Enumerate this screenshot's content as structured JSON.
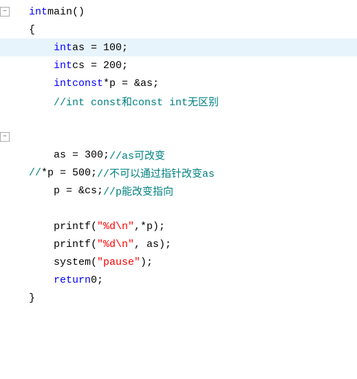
{
  "editor": {
    "lines": [
      {
        "id": "line-1",
        "indent": 0,
        "collapsible": true,
        "collapsed": false,
        "hasGuide": false,
        "tokens": [
          {
            "type": "kw-blue",
            "text": "int"
          },
          {
            "type": "normal",
            "text": " main()"
          }
        ]
      },
      {
        "id": "line-2",
        "indent": 0,
        "collapsible": false,
        "collapsed": false,
        "hasGuide": true,
        "tokens": [
          {
            "type": "normal",
            "text": "{"
          }
        ]
      },
      {
        "id": "line-3",
        "indent": 1,
        "collapsible": false,
        "collapsed": false,
        "hasGuide": true,
        "highlighted": true,
        "tokens": [
          {
            "type": "kw-blue",
            "text": "int"
          },
          {
            "type": "normal",
            "text": " as = 100;"
          }
        ]
      },
      {
        "id": "line-4",
        "indent": 1,
        "collapsible": false,
        "collapsed": false,
        "hasGuide": true,
        "tokens": [
          {
            "type": "kw-blue",
            "text": "int"
          },
          {
            "type": "normal",
            "text": " cs = 200;"
          }
        ]
      },
      {
        "id": "line-5",
        "indent": 1,
        "collapsible": false,
        "collapsed": false,
        "hasGuide": true,
        "tokens": [
          {
            "type": "kw-blue",
            "text": "int"
          },
          {
            "type": "normal",
            "text": " "
          },
          {
            "type": "kw-blue",
            "text": "const"
          },
          {
            "type": "normal",
            "text": " *p = &as;"
          }
        ]
      },
      {
        "id": "line-6",
        "indent": 1,
        "collapsible": false,
        "collapsed": false,
        "hasGuide": true,
        "tokens": [
          {
            "type": "comment",
            "text": "//int const和const int无区别"
          }
        ]
      },
      {
        "id": "line-7",
        "indent": 0,
        "collapsible": false,
        "collapsed": false,
        "hasGuide": false,
        "tokens": []
      },
      {
        "id": "line-8",
        "indent": 0,
        "collapsible": true,
        "collapsed": false,
        "hasGuide": false,
        "tokens": []
      },
      {
        "id": "line-9",
        "indent": 1,
        "collapsible": false,
        "collapsed": false,
        "hasGuide": true,
        "tokens": [
          {
            "type": "normal",
            "text": "as = 300;"
          },
          {
            "type": "comment",
            "text": "//as可改变"
          }
        ]
      },
      {
        "id": "line-10",
        "indent": 0,
        "collapsible": false,
        "collapsed": false,
        "hasGuide": false,
        "commentPrefix": true,
        "tokens": [
          {
            "type": "comment",
            "text": "//"
          },
          {
            "type": "normal",
            "text": "   *p = 500;"
          },
          {
            "type": "comment",
            "text": "//不可以通过指针改变as"
          }
        ]
      },
      {
        "id": "line-11",
        "indent": 1,
        "collapsible": false,
        "collapsed": false,
        "hasGuide": true,
        "tokens": [
          {
            "type": "normal",
            "text": "p = &cs;"
          },
          {
            "type": "comment",
            "text": "//p能改变指向"
          }
        ]
      },
      {
        "id": "line-12",
        "indent": 0,
        "collapsible": false,
        "collapsed": false,
        "hasGuide": false,
        "tokens": []
      },
      {
        "id": "line-13",
        "indent": 1,
        "collapsible": false,
        "collapsed": false,
        "hasGuide": true,
        "tokens": [
          {
            "type": "normal",
            "text": "printf("
          },
          {
            "type": "string",
            "text": "\"%d\\n\""
          },
          {
            "type": "normal",
            "text": ",*p);"
          }
        ]
      },
      {
        "id": "line-14",
        "indent": 1,
        "collapsible": false,
        "collapsed": false,
        "hasGuide": true,
        "tokens": [
          {
            "type": "normal",
            "text": "printf("
          },
          {
            "type": "string",
            "text": "\"%d\\n\""
          },
          {
            "type": "normal",
            "text": ", as);"
          }
        ]
      },
      {
        "id": "line-15",
        "indent": 1,
        "collapsible": false,
        "collapsed": false,
        "hasGuide": true,
        "tokens": [
          {
            "type": "normal",
            "text": "system("
          },
          {
            "type": "string",
            "text": "\"pause\""
          },
          {
            "type": "normal",
            "text": ");"
          }
        ]
      },
      {
        "id": "line-16",
        "indent": 1,
        "collapsible": false,
        "collapsed": false,
        "hasGuide": true,
        "tokens": [
          {
            "type": "kw-blue",
            "text": "return"
          },
          {
            "type": "normal",
            "text": " 0;"
          }
        ]
      },
      {
        "id": "line-17",
        "indent": 0,
        "collapsible": false,
        "collapsed": false,
        "hasGuide": false,
        "tokens": [
          {
            "type": "normal",
            "text": "}"
          }
        ]
      }
    ]
  }
}
